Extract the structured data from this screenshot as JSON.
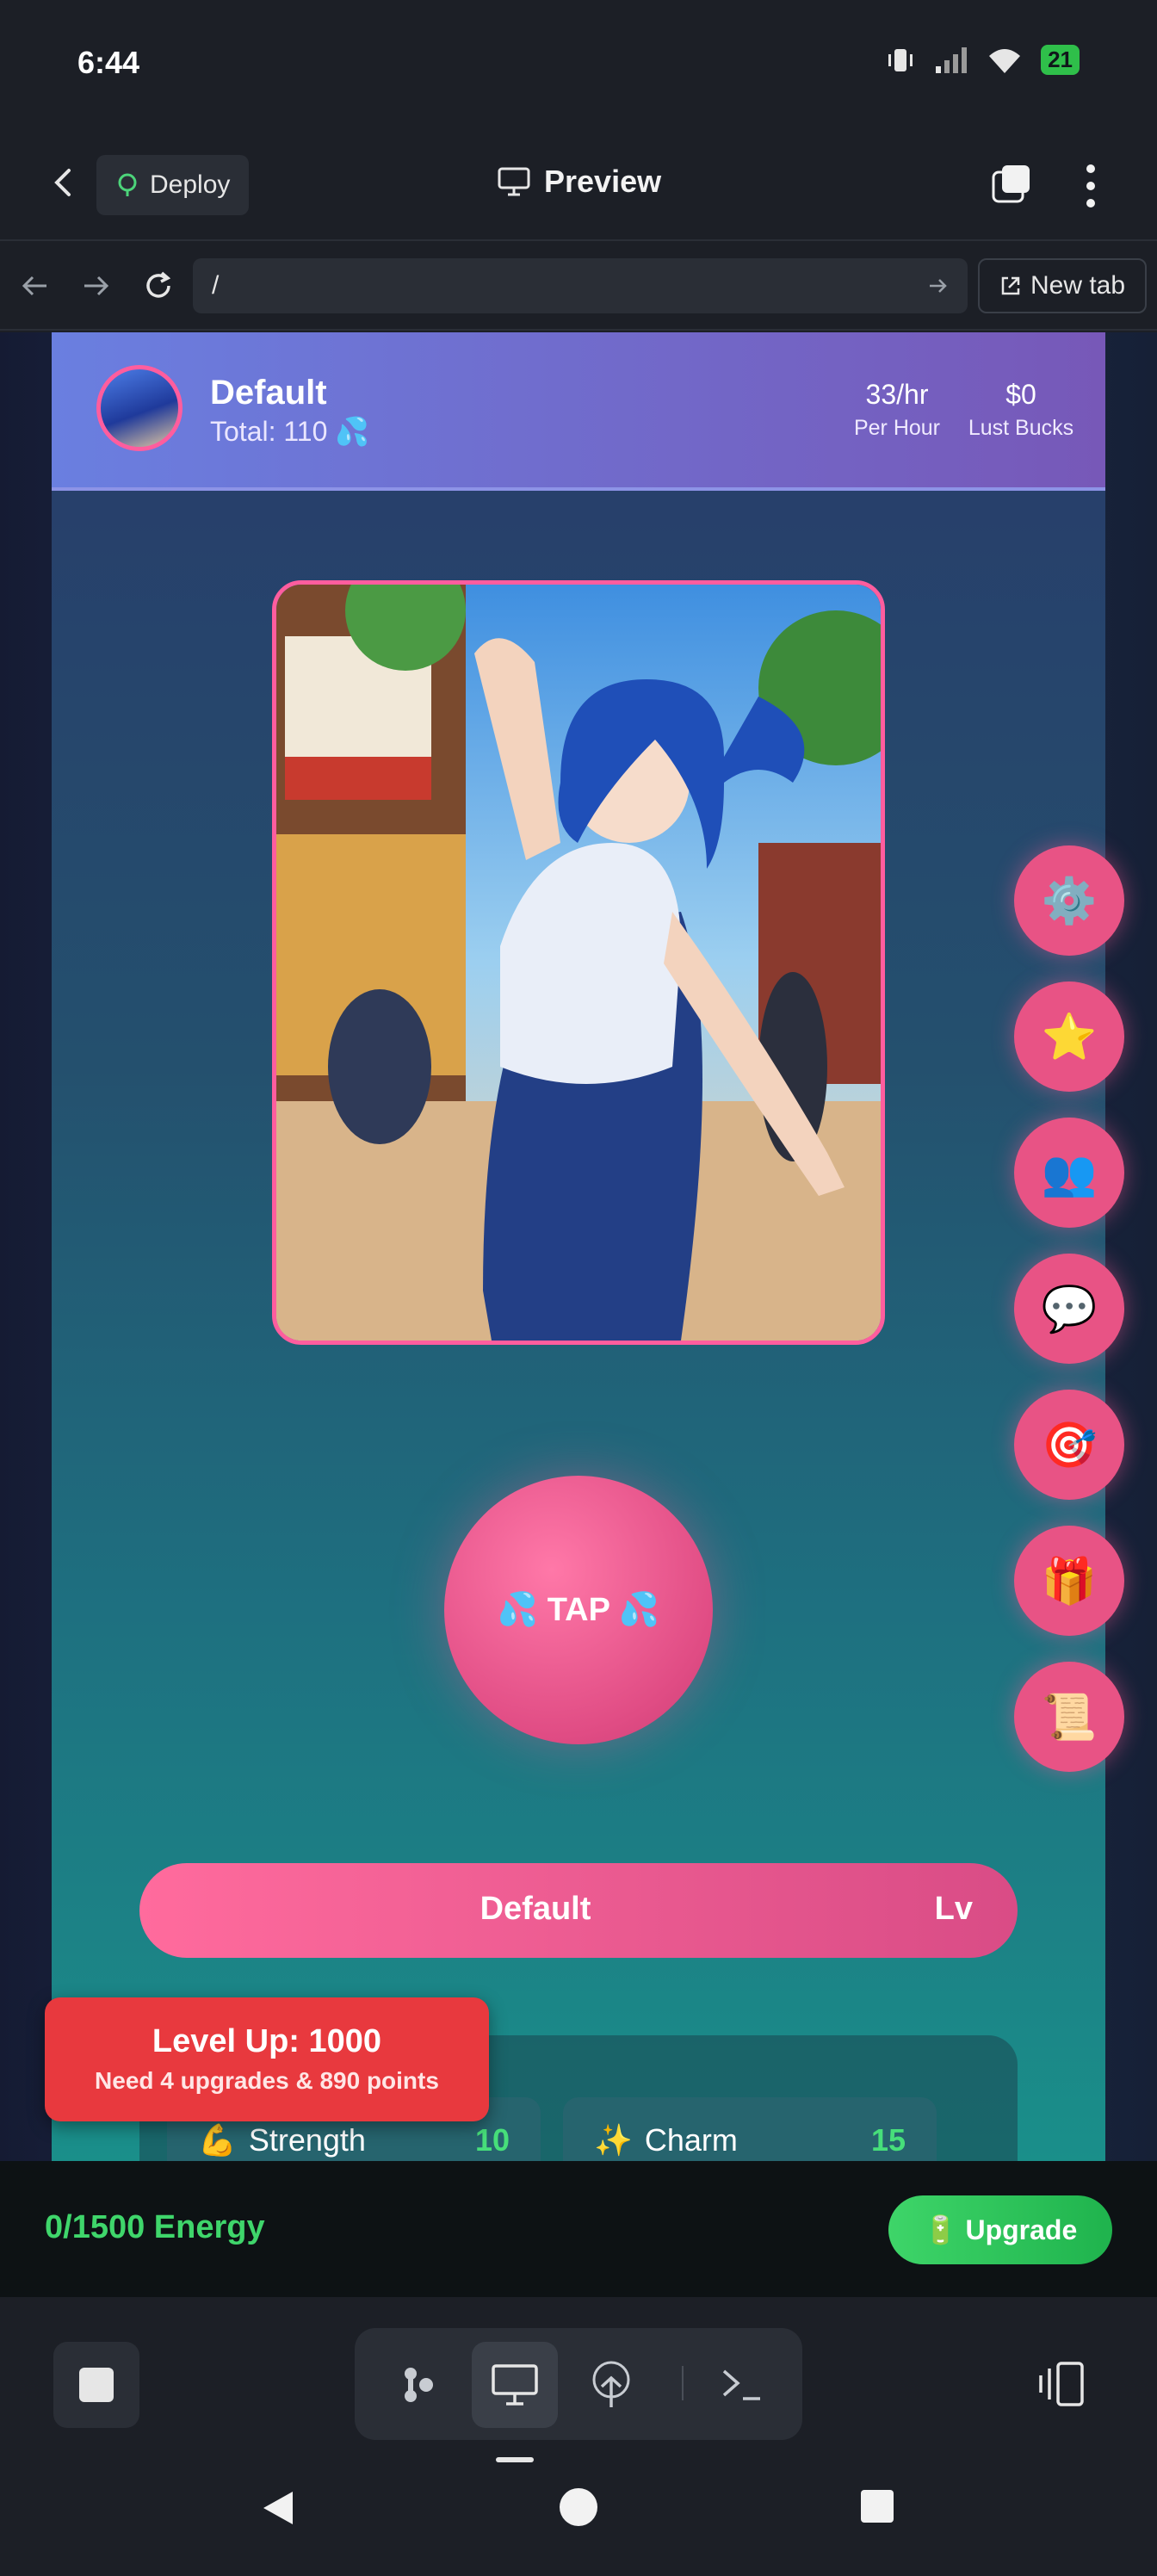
{
  "status": {
    "time": "6:44",
    "battery": "21"
  },
  "app_header": {
    "deploy_label": "Deploy",
    "title": "Preview"
  },
  "browser": {
    "url": "/",
    "new_tab_label": "New tab"
  },
  "game": {
    "character_name": "Default",
    "total_text": "Total: 110 💦",
    "per_hour_value": "33/hr",
    "per_hour_label": "Per Hour",
    "bucks_value": "$0",
    "bucks_label": "Lust Bucks",
    "tap_label": "💦 TAP 💦",
    "side_buttons": [
      {
        "icon": "⚙️",
        "name": "settings"
      },
      {
        "icon": "⭐",
        "name": "favorites"
      },
      {
        "icon": "👥",
        "name": "characters"
      },
      {
        "icon": "💬",
        "name": "chat"
      },
      {
        "icon": "🎯",
        "name": "tasks"
      },
      {
        "icon": "🎁",
        "name": "gifts"
      },
      {
        "icon": "📜",
        "name": "scroll"
      }
    ],
    "level_bar_name": "Default",
    "level_bar_lv": "Lv",
    "attributes": [
      {
        "icon": "💪",
        "name": "Strength",
        "value": "10"
      },
      {
        "icon": "✨",
        "name": "Charm",
        "value": "15"
      }
    ],
    "toast": {
      "title": "Level Up: 1000",
      "subtitle": "Need 4 upgrades & 890 points"
    },
    "energy_text": "0/1500 Energy",
    "upgrade_label": "🔋 Upgrade"
  }
}
